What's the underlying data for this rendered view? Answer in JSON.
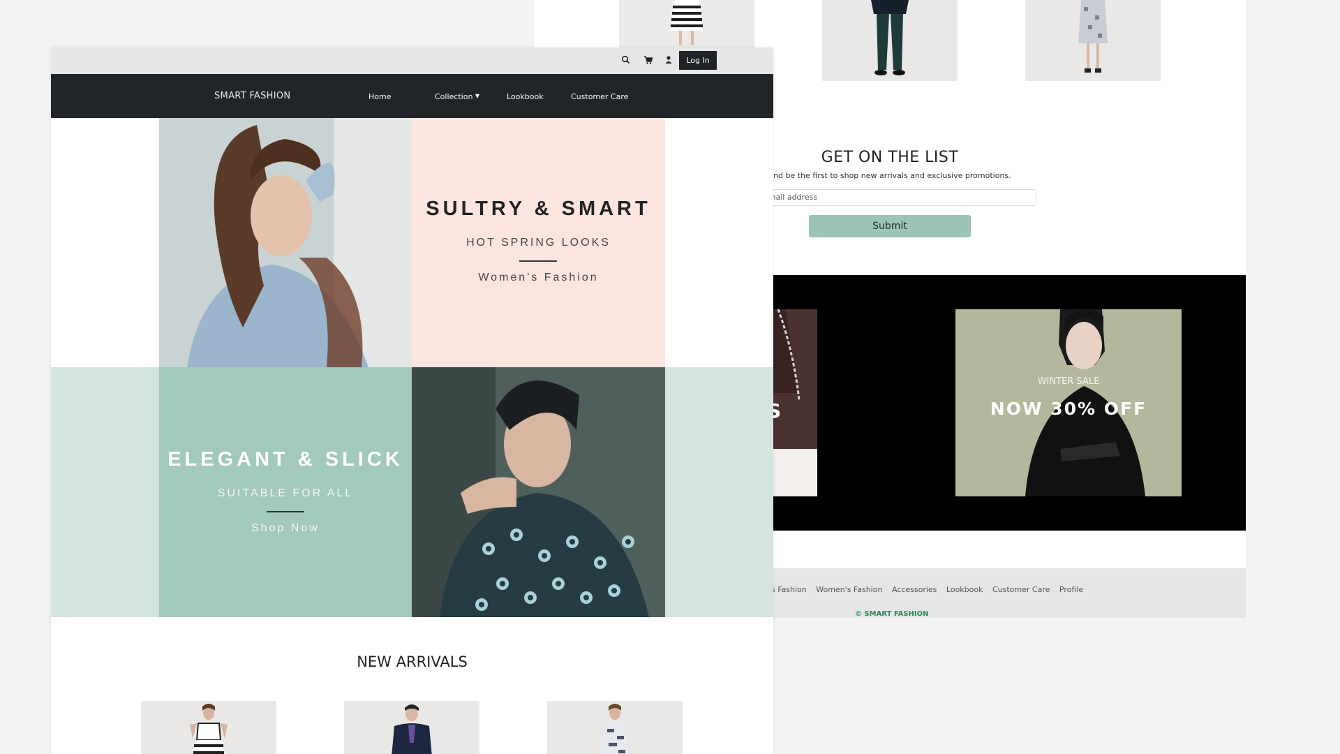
{
  "back_window": {
    "signup": {
      "title": "GET ON THE LIST",
      "subtitle": "and be the first to shop new arrivals and exclusive promotions.",
      "email_placeholder": "email address",
      "submit_label": "Submit"
    },
    "promo": {
      "sale_label": "WINTER SALE",
      "offer": "NOW 30% OFF",
      "partial_letter": "S"
    },
    "footer": {
      "links": [
        "s Fashion",
        "Women's Fashion",
        "Accessories",
        "Lookbook",
        "Customer Care",
        "Profile"
      ],
      "copyright": "© SMART FASHION"
    }
  },
  "front_window": {
    "topbar": {
      "icons": [
        "search-icon",
        "cart-icon",
        "user-icon"
      ],
      "login_label": "Log In"
    },
    "navbar": {
      "brand": "SMART FASHION",
      "items": [
        "Home",
        "Collection",
        "Lookbook",
        "Customer Care"
      ]
    },
    "hero": {
      "women": {
        "headline": "SULTRY & SMART",
        "subline": "HOT SPRING LOOKS",
        "tagline": "Women's Fashion"
      },
      "men": {
        "headline": "ELEGANT & SLICK",
        "subline": "SUITABLE FOR ALL",
        "tagline": "Shop Now"
      }
    },
    "new_arrivals_title": "NEW ARRIVALS"
  },
  "colors": {
    "page_bg": "#f4f3f1",
    "nav_bg": "#212529",
    "pink_panel": "#fde5df",
    "mint_panel": "#a3c8bd",
    "mint_light": "#d4e4e0",
    "submit_bg": "#9cc5b8",
    "copyright_green": "#2c8a5c"
  }
}
